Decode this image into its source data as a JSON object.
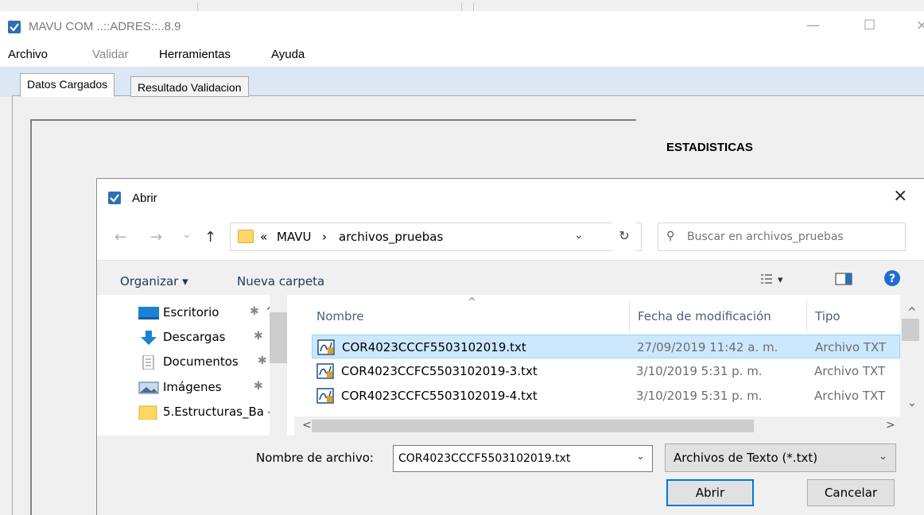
{
  "app": {
    "title": "MAVU COM ..::ADRES::..8.9",
    "minimize_glyph": "—",
    "maximize_glyph": "☐",
    "close_glyph": "×"
  },
  "menu": {
    "items": [
      {
        "label": "Archivo",
        "enabled": true
      },
      {
        "label": "Validar",
        "enabled": false
      },
      {
        "label": "Herramientas",
        "enabled": true
      },
      {
        "label": "Ayuda",
        "enabled": true
      }
    ]
  },
  "tabs": [
    {
      "label": "Datos Cargados",
      "active": true
    },
    {
      "label": "Resultado Validacion",
      "active": false
    }
  ],
  "main": {
    "stats_heading": "ESTADISTICAS"
  },
  "dialog": {
    "title": "Abrir",
    "close_glyph": "×",
    "nav": {
      "back_glyph": "←",
      "forward_glyph": "→",
      "recent_glyph": "⌄",
      "up_glyph": "↑",
      "refresh_glyph": "↻"
    },
    "breadcrumb": {
      "overflow": "«",
      "separator": "›",
      "segments": [
        "MAVU",
        "archivos_pruebas"
      ],
      "dropdown_glyph": "⌄"
    },
    "search": {
      "placeholder": "Buscar en archivos_pruebas",
      "icon_glyph": "⚲"
    },
    "commands": {
      "organize": "Organizar ▾",
      "new_folder": "Nueva carpeta",
      "view_glyph": "▾",
      "help_glyph": "?"
    },
    "nav_pane": {
      "items": [
        {
          "label": "Escritorio",
          "icon": "desktop-icon"
        },
        {
          "label": "Descargas",
          "icon": "download-icon"
        },
        {
          "label": "Documentos",
          "icon": "documents-icon"
        },
        {
          "label": "Imágenes",
          "icon": "pictures-icon"
        },
        {
          "label": "5.Estructuras_Ba",
          "icon": "folder-icon"
        }
      ],
      "pin_glyph": "✱",
      "scroll_up_glyph": "^",
      "expand_glyph": "⌄"
    },
    "file_list": {
      "columns": [
        "Nombre",
        "Fecha de modificación",
        "Tipo"
      ],
      "sort_glyph": "^",
      "rows": [
        {
          "name": "COR4023CCCF5503102019.txt",
          "date": "27/09/2019 11:42 a. m.",
          "type": "Archivo TXT",
          "selected": true
        },
        {
          "name": "COR4023CCFC5503102019-3.txt",
          "date": "3/10/2019 5:31 p. m.",
          "type": "Archivo TXT",
          "selected": false
        },
        {
          "name": "COR4023CCFC5503102019-4.txt",
          "date": "3/10/2019 5:31 p. m.",
          "type": "Archivo TXT",
          "selected": false
        }
      ],
      "scroll_left_glyph": "<",
      "scroll_right_glyph": ">",
      "scroll_up_glyph": "^",
      "scroll_down_glyph": "⌄"
    },
    "filename_label": "Nombre de archivo:",
    "filename_value": "COR4023CCCF5503102019.txt",
    "filter_value": "Archivos de Texto (*.txt)",
    "dropdown_glyph": "⌄",
    "open_button": "Abrir",
    "cancel_button": "Cancelar"
  },
  "colors": {
    "accent": "#0078d7",
    "selection_bg": "#cce8ff",
    "tabstrip_bg": "#dbe7f4",
    "help_blue": "#1f6dd0",
    "folder_yellow": "#ffd766"
  }
}
